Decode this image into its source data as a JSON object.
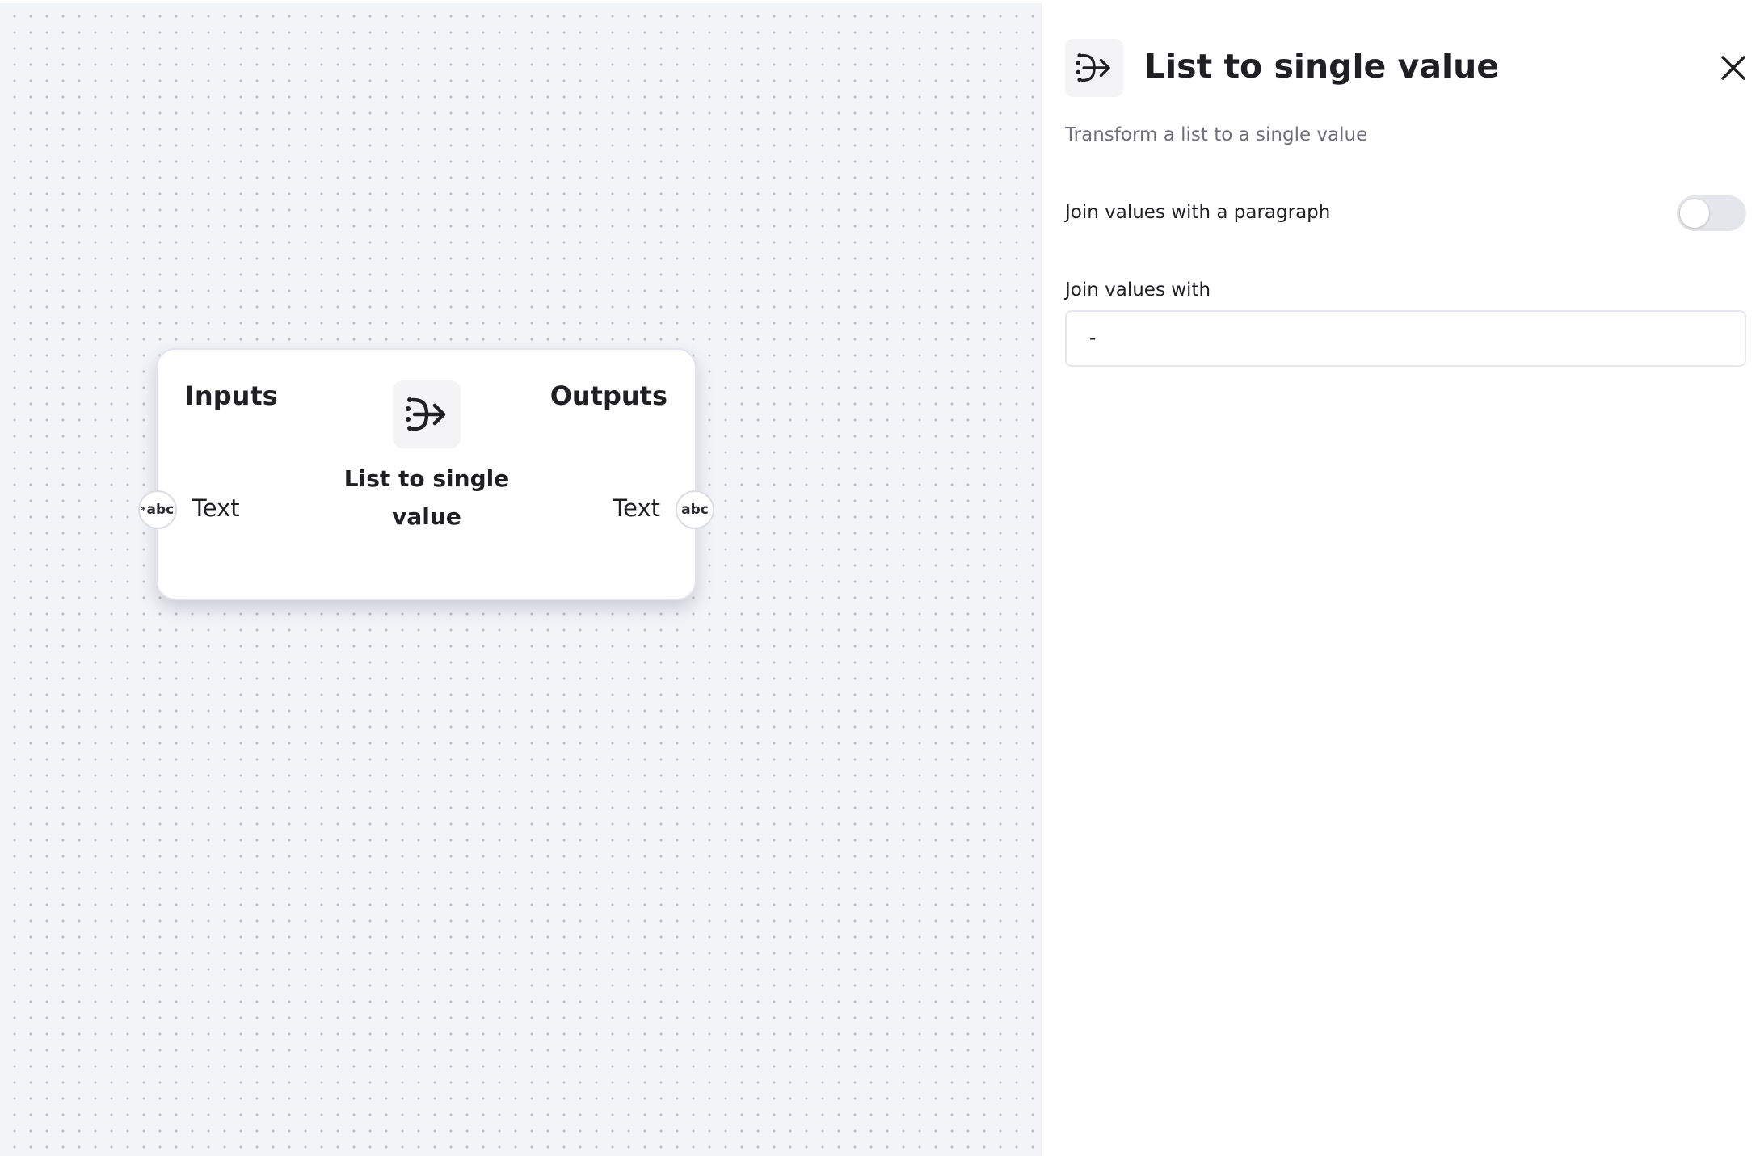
{
  "node": {
    "inputs_heading": "Inputs",
    "outputs_heading": "Outputs",
    "icon": "list-merge-icon",
    "title": "List to single value",
    "input": {
      "label": "Text",
      "type_badge": "abc",
      "required_marker": "*"
    },
    "output": {
      "label": "Text",
      "type_badge": "abc"
    }
  },
  "panel": {
    "icon": "list-merge-icon",
    "title": "List to single value",
    "description": "Transform a list to a single value",
    "close_icon": "close-icon",
    "paragraph_toggle": {
      "label": "Join values with a paragraph",
      "checked": false
    },
    "join_field": {
      "label": "Join values with",
      "value": "-"
    }
  },
  "colors": {
    "canvas_background": "#f3f4f8",
    "grid_dot": "#b9bcc7",
    "panel_background": "#ffffff",
    "toggle_off": "#e5e6eb",
    "text": "#1f1f24",
    "muted_text": "#6f6f7a"
  }
}
